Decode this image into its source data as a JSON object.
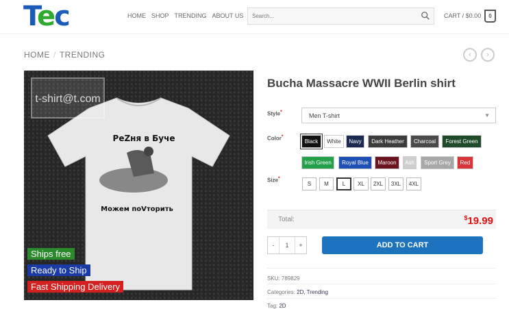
{
  "header": {
    "logo_text": [
      "T",
      "e",
      "c"
    ],
    "nav": [
      "HOME",
      "SHOP",
      "TRENDING",
      "ABOUT US"
    ],
    "search_placeholder": "Search...",
    "cart_label": "CART / $0.00",
    "cart_count": "0"
  },
  "breadcrumb": [
    "HOME",
    "TRENDING"
  ],
  "image": {
    "watermark": "t-shirt@t.com",
    "shirt_top_text": "РеZня в Буче",
    "shirt_bottom_text": "Можем поVторить",
    "badges": [
      "Ships free",
      "Ready to Ship",
      "Fast Shipping Delivery"
    ]
  },
  "product": {
    "title": "Bucha Massacre WWII Berlin shirt",
    "style_label": "Style",
    "style_value": "Men T-shirt",
    "color_label": "Color",
    "colors": [
      {
        "name": "Black",
        "bg": "#111111",
        "fg": "#ffffff",
        "selected": true
      },
      {
        "name": "White",
        "bg": "#ffffff",
        "fg": "#333333",
        "selected": false
      },
      {
        "name": "Navy",
        "bg": "#1c2a52",
        "fg": "#ffffff",
        "selected": false
      },
      {
        "name": "Dark Heather",
        "bg": "#3c3c3c",
        "fg": "#ffffff",
        "selected": false
      },
      {
        "name": "Charcoal",
        "bg": "#4a4a4a",
        "fg": "#ffffff",
        "selected": false
      },
      {
        "name": "Forest Green",
        "bg": "#1f4b2a",
        "fg": "#ffffff",
        "selected": false
      },
      {
        "name": "Irish Green",
        "bg": "#22a04a",
        "fg": "#ffffff",
        "selected": false
      },
      {
        "name": "Royal Blue",
        "bg": "#1e4fb5",
        "fg": "#ffffff",
        "selected": false
      },
      {
        "name": "Maroon",
        "bg": "#6a1420",
        "fg": "#ffffff",
        "selected": false
      },
      {
        "name": "Ash",
        "bg": "#cfcfcf",
        "fg": "#ffffff",
        "selected": false
      },
      {
        "name": "Sport Grey",
        "bg": "#a8a8a8",
        "fg": "#ffffff",
        "selected": false
      },
      {
        "name": "Red",
        "bg": "#d8353a",
        "fg": "#ffffff",
        "selected": false
      }
    ],
    "size_label": "Size",
    "sizes": [
      {
        "name": "S",
        "selected": false
      },
      {
        "name": "M",
        "selected": false
      },
      {
        "name": "L",
        "selected": true
      },
      {
        "name": "XL",
        "selected": false
      },
      {
        "name": "2XL",
        "selected": false
      },
      {
        "name": "3XL",
        "selected": false
      },
      {
        "name": "4XL",
        "selected": false
      }
    ],
    "total_label": "Total:",
    "price_symbol": "$",
    "price": "19.99",
    "qty_minus": "-",
    "qty_value": "1",
    "qty_plus": "+",
    "add_to_cart": "ADD TO CART",
    "sku": "SKU: 789829",
    "categories_label": "Categories:",
    "categories": "2D, Trending",
    "tag_label": "Tag:",
    "tag": "2D"
  },
  "colors": {
    "accent": "#1e73be",
    "price": "#dd1111"
  }
}
